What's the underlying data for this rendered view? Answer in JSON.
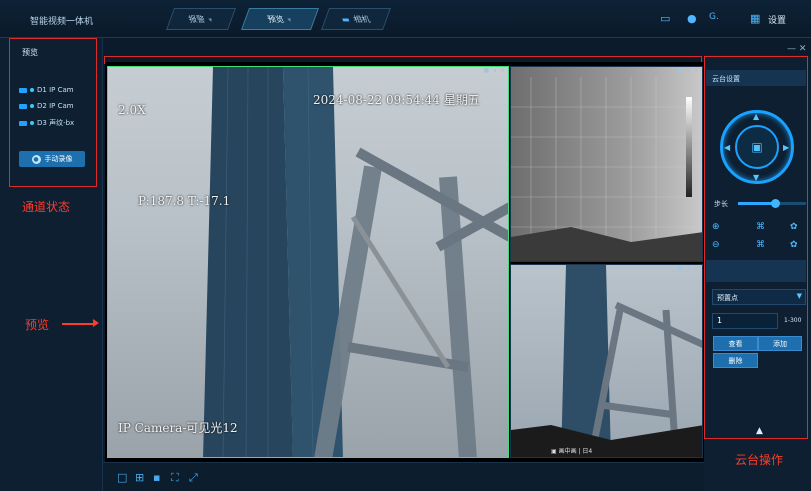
{
  "app": {
    "title": "智能视频一体机",
    "settings_label": "设置"
  },
  "tabs": [
    {
      "label": "报警",
      "active": false
    },
    {
      "label": "预览",
      "active": true
    },
    {
      "label": "相机",
      "active": false
    }
  ],
  "left_panel": {
    "title": "预览",
    "cameras": [
      "D1 IP Cam",
      "D2 IP Cam",
      "D3 声纹-bx"
    ],
    "record_button": "手动录像"
  },
  "annotations": {
    "channel_status": "通道状态",
    "preview": "预览",
    "ptz_ops": "云台操作"
  },
  "video": {
    "main": {
      "zoom": "2.0X",
      "timestamp": "2024-08-22 09:54:44 星期五",
      "ptz_readout": "P:187.8 T:-17.1",
      "camera_name": "IP Camera-可见光12"
    },
    "win_header": "■ ◂ ✕",
    "win3_caption": "▣ 画中画 | 日4"
  },
  "right_panel": {
    "ptz_title": "云台设置",
    "step_label": "步长",
    "step_value": 0.55,
    "preset_label": "预置点",
    "preset_value": "1",
    "preset_range": "1-300",
    "buttons": {
      "view": "查看",
      "add": "添加",
      "delete": "删除"
    }
  },
  "icons": {
    "monitor": "monitor-icon",
    "user": "user-icon",
    "theme": "theme-icon",
    "grid": "grid-icon"
  },
  "colors": {
    "accent": "#1aa2ff",
    "annotation": "#ff3b2a",
    "active_tile": "#3fe07a"
  }
}
